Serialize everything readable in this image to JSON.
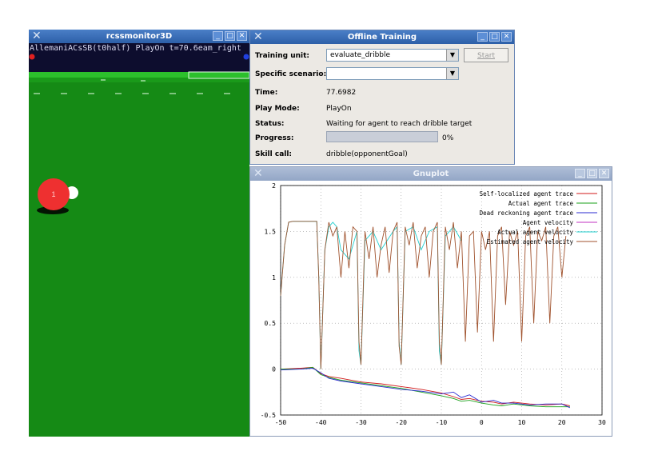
{
  "monitor": {
    "title": "rcssmonitor3D",
    "status_line": "AllemaniACsSB(t0half) PlayOn t=70.6eam_right",
    "player_number": "1"
  },
  "training": {
    "title": "Offline Training",
    "training_unit_label": "Training unit:",
    "training_unit_value": "evaluate_dribble",
    "start_label": "Start",
    "scenario_label": "Specific scenario:",
    "scenario_value": "",
    "time_label": "Time:",
    "time_value": "77.6982",
    "playmode_label": "Play Mode:",
    "playmode_value": "PlayOn",
    "status_label": "Status:",
    "status_value": "Waiting for agent to reach dribble target",
    "progress_label": "Progress:",
    "progress_value": 0,
    "progress_text": "0%",
    "skill_label": "Skill call:",
    "skill_value": "dribble(opponentGoal)"
  },
  "gnuplot": {
    "title": "Gnuplot"
  },
  "chart_data": {
    "type": "line",
    "title": "",
    "xlabel": "",
    "ylabel": "",
    "xlim": [
      -50,
      30
    ],
    "ylim": [
      -0.5,
      2
    ],
    "xticks": [
      -50,
      -40,
      -30,
      -20,
      -10,
      0,
      10,
      20,
      30
    ],
    "yticks": [
      -0.5,
      0,
      0.5,
      1,
      1.5,
      2
    ],
    "grid": true,
    "legend_position": "top-right",
    "series": [
      {
        "name": "Self-localized agent trace",
        "color": "#d11a1a",
        "x": [
          -50,
          -45,
          -42,
          -40,
          -38,
          -35,
          -30,
          -25,
          -20,
          -15,
          -10,
          -7,
          -5,
          -3,
          0,
          3,
          5,
          8,
          12,
          16,
          20,
          22
        ],
        "y": [
          0.0,
          0.01,
          0.02,
          -0.05,
          -0.08,
          -0.1,
          -0.14,
          -0.16,
          -0.19,
          -0.22,
          -0.26,
          -0.3,
          -0.33,
          -0.32,
          -0.35,
          -0.36,
          -0.38,
          -0.36,
          -0.38,
          -0.39,
          -0.38,
          -0.4
        ]
      },
      {
        "name": "Actual agent trace",
        "color": "#1aa01a",
        "x": [
          -50,
          -45,
          -42,
          -40,
          -38,
          -35,
          -30,
          -25,
          -20,
          -15,
          -10,
          -7,
          -5,
          -3,
          0,
          3,
          5,
          8,
          12,
          16,
          20,
          22
        ],
        "y": [
          0.0,
          0.0,
          0.02,
          -0.06,
          -0.09,
          -0.12,
          -0.15,
          -0.18,
          -0.21,
          -0.25,
          -0.29,
          -0.32,
          -0.35,
          -0.34,
          -0.37,
          -0.39,
          -0.4,
          -0.38,
          -0.4,
          -0.41,
          -0.41,
          -0.41
        ]
      },
      {
        "name": "Dead reckoning agent trace",
        "color": "#2a2ad0",
        "x": [
          -50,
          -45,
          -42,
          -40,
          -38,
          -35,
          -30,
          -25,
          -20,
          -15,
          -10,
          -7,
          -5,
          -3,
          0,
          3,
          5,
          8,
          12,
          16,
          20,
          22
        ],
        "y": [
          -0.01,
          0.0,
          0.01,
          -0.04,
          -0.1,
          -0.13,
          -0.16,
          -0.19,
          -0.22,
          -0.24,
          -0.27,
          -0.25,
          -0.31,
          -0.28,
          -0.36,
          -0.34,
          -0.37,
          -0.37,
          -0.39,
          -0.38,
          -0.38,
          -0.42
        ]
      },
      {
        "name": "Agent velocity",
        "color": "#c030c0",
        "x": [],
        "y": []
      },
      {
        "name": "Actual agent velocity",
        "color": "#20d0d0",
        "x": [
          -50,
          -49,
          -48,
          -47,
          -45,
          -42,
          -41,
          -40.5,
          -40,
          -39,
          -38,
          -37,
          -36,
          -35,
          -33,
          -31,
          -30.5,
          -30,
          -29,
          -27,
          -25,
          -22,
          -21,
          -20.5,
          -20,
          -19,
          -17,
          -15,
          -13,
          -11,
          -10.5,
          -10,
          -9,
          -7,
          -5
        ],
        "y": [
          0.8,
          1.35,
          1.6,
          1.61,
          1.61,
          1.61,
          1.61,
          1.0,
          0.0,
          1.3,
          1.55,
          1.6,
          1.55,
          1.3,
          1.2,
          1.5,
          0.2,
          0.05,
          1.4,
          1.5,
          1.3,
          1.5,
          1.55,
          0.3,
          0.05,
          1.5,
          1.55,
          1.3,
          1.5,
          1.55,
          0.2,
          0.05,
          1.45,
          1.55,
          1.4
        ]
      },
      {
        "name": "Estimated agent velocity",
        "color": "#a0522d",
        "x": [
          -50,
          -49,
          -48,
          -47,
          -45,
          -42,
          -41,
          -40.5,
          -40,
          -39,
          -38,
          -37,
          -36,
          -35,
          -34,
          -33,
          -32,
          -31,
          -30.5,
          -30,
          -29,
          -28,
          -27,
          -26,
          -25,
          -24,
          -23,
          -22,
          -21,
          -20.5,
          -20,
          -19,
          -18,
          -17,
          -16,
          -15,
          -14,
          -13,
          -12,
          -11,
          -10.5,
          -10,
          -9,
          -8,
          -7,
          -6,
          -5,
          -4,
          -3,
          -2,
          -1,
          0,
          1,
          2,
          3,
          4,
          5,
          6,
          7,
          8,
          9,
          10,
          11,
          12,
          13,
          14,
          15,
          16,
          17,
          18,
          19,
          20,
          21
        ],
        "y": [
          0.8,
          1.35,
          1.6,
          1.61,
          1.61,
          1.61,
          1.61,
          1.0,
          0.0,
          1.3,
          1.6,
          1.45,
          1.55,
          1.0,
          1.5,
          1.1,
          1.55,
          1.5,
          0.3,
          0.05,
          1.5,
          1.2,
          1.55,
          1.0,
          1.35,
          1.55,
          1.05,
          1.5,
          1.6,
          0.25,
          0.05,
          1.55,
          1.35,
          1.6,
          1.1,
          1.45,
          1.55,
          1.0,
          1.5,
          1.6,
          0.3,
          0.05,
          1.55,
          1.3,
          1.6,
          1.1,
          1.5,
          0.3,
          1.45,
          1.5,
          0.4,
          1.5,
          1.3,
          1.5,
          0.3,
          1.45,
          1.55,
          0.7,
          1.5,
          1.35,
          1.5,
          0.3,
          1.45,
          1.55,
          0.5,
          1.5,
          1.4,
          1.55,
          0.5,
          1.45,
          1.55,
          1.0,
          1.45
        ]
      }
    ]
  }
}
